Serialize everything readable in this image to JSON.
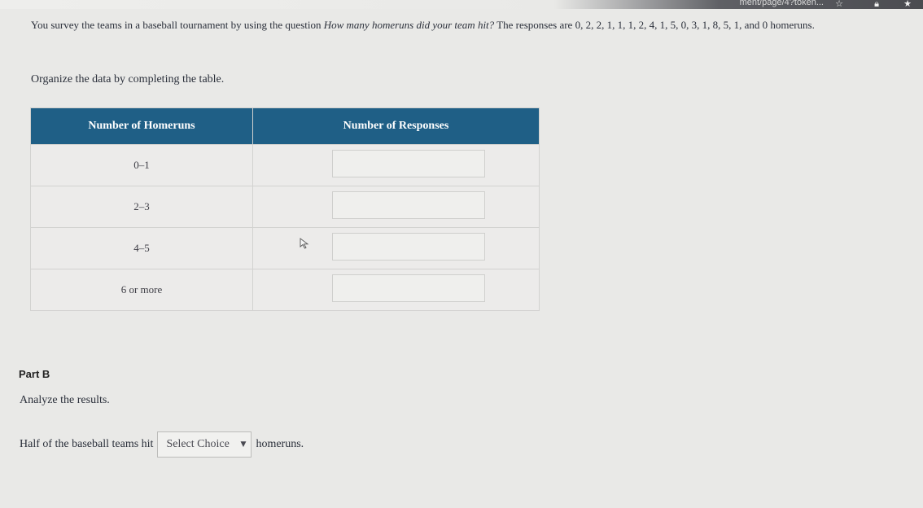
{
  "browser": {
    "url_fragment": "ment/page/4?token...",
    "star_icon": "star-icon",
    "lock_icon": "lock-icon",
    "bookmark_icon": "star-icon"
  },
  "question": {
    "text_before": "You survey the teams in a baseball tournament by using the question ",
    "italic": "How many homeruns did your team hit?",
    "text_after": " The responses are 0, 2, 2, 1, 1, 1, 2, 4, 1, 5, 0, 3, 1, 8, 5, 1, and 0 homeruns."
  },
  "instruction": "Organize the data by completing the table.",
  "table": {
    "headers": [
      "Number of Homeruns",
      "Number of Responses"
    ],
    "rows": [
      {
        "range": "0–1",
        "value": ""
      },
      {
        "range": "2–3",
        "value": ""
      },
      {
        "range": "4–5",
        "value": ""
      },
      {
        "range": "6 or more",
        "value": ""
      }
    ],
    "header_color": "#1f5f86"
  },
  "part_b": {
    "title": "Part B",
    "prompt": "Analyze the results.",
    "sentence_before": "Half of the baseball teams hit",
    "select_value": "Select Choice",
    "sentence_after": "homeruns."
  }
}
